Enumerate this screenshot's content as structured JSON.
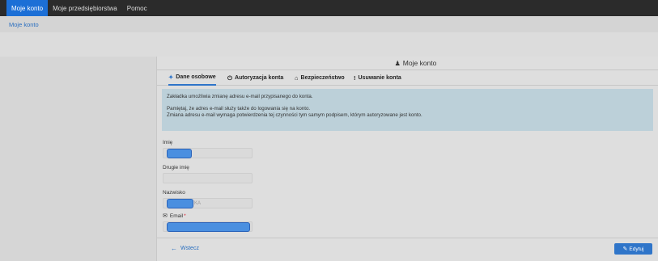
{
  "topnav": {
    "items": [
      "Moje konto",
      "Moje przedsiębiorstwa",
      "Pomoc"
    ]
  },
  "breadcrumb": "Moje konto",
  "panel": {
    "title": "Moje konto",
    "tabs": [
      "Dane osobowe",
      "Autoryzacja konta",
      "Bezpieczeństwo",
      "Usuwanie konta"
    ],
    "info": [
      "Zakładka umożliwia zmianę adresu e-mail przypisanego do konta.",
      "Pamiętaj, że adres e-mail służy także do logowania się na konto.",
      "Zmiana adresu e-mail wymaga potwierdzenia tej czynności tym samym podpisem, którym autoryzowane jest konto."
    ],
    "fields": {
      "first_name_label": "Imię",
      "second_name_label": "Drugie imię",
      "last_name_label": "Nazwisko",
      "last_name_visible_suffix": "KA",
      "email_label": "Email",
      "required_mark": "*"
    },
    "back_label": "Wstecz",
    "edit_label": "Edytuj"
  },
  "colors": {
    "accent": "#2f75c9",
    "topbar": "#2b2b2b",
    "info_bg": "#bcd0d9"
  },
  "icons": {
    "user": "user-icon",
    "person": "person-icon",
    "power": "power-icon",
    "lock": "lock-icon",
    "exclamation": "exclamation-icon",
    "mail": "mail-icon",
    "back": "arrow-left-icon",
    "edit": "edit-icon"
  }
}
